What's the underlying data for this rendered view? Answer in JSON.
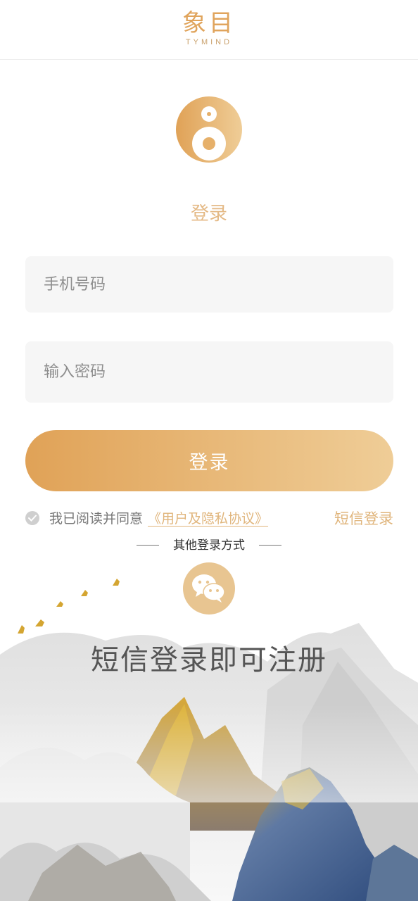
{
  "header": {
    "brand_cn": "象目",
    "brand_en": "TYMIND"
  },
  "login": {
    "title": "登录",
    "phone_placeholder": "手机号码",
    "password_placeholder": "输入密码",
    "button_label": "登录"
  },
  "agreement": {
    "text": "我已阅读并同意",
    "link": "《用户及隐私协议》",
    "sms_login": "短信登录"
  },
  "other_login": {
    "label": "其他登录方式",
    "wechat_icon": "wechat-icon"
  },
  "slogan": "短信登录即可注册",
  "colors": {
    "accent": "#e0a257",
    "accent_light": "#efcd97",
    "link": "#e0b57c",
    "field_bg": "#f6f6f6"
  }
}
